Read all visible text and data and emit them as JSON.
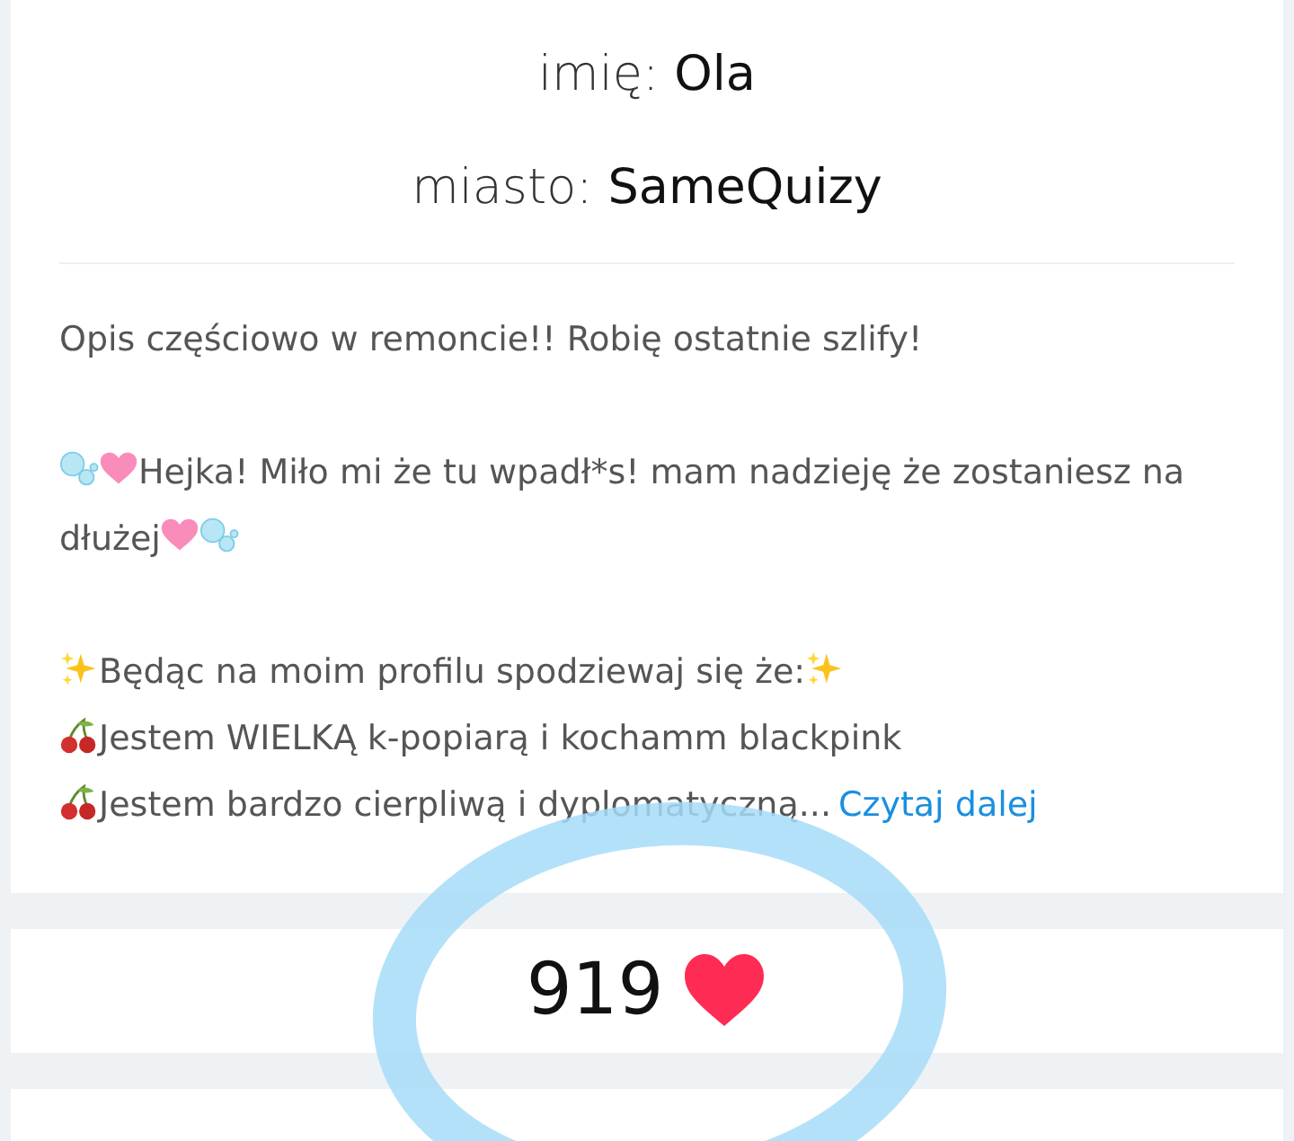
{
  "profile_fields": [
    {
      "label": "imię:",
      "value": "Ola"
    },
    {
      "label": "miasto:",
      "value": "SameQuizy"
    }
  ],
  "description": {
    "paragraphs": [
      [
        [
          {
            "kind": "text",
            "text": "Opis częściowo w remoncie!! Robię ostatnie szlify!"
          }
        ]
      ],
      [
        [
          {
            "kind": "bubbles"
          },
          {
            "kind": "heart"
          },
          {
            "kind": "text",
            "text": "Hejka! Miło mi że tu wpadł*s! mam nadzieję że zostaniesz na"
          }
        ],
        [
          {
            "kind": "text",
            "text": "dłużej"
          },
          {
            "kind": "heart"
          },
          {
            "kind": "bubbles"
          }
        ]
      ],
      [
        [
          {
            "kind": "sparkles"
          },
          {
            "kind": "text",
            "text": "Będąc na moim profilu spodziewaj się że:"
          },
          {
            "kind": "sparkles"
          }
        ],
        [
          {
            "kind": "cherries"
          },
          {
            "kind": "text",
            "text": "Jestem WIELKĄ k-popiarą i kochamm blackpink"
          }
        ],
        [
          {
            "kind": "cherries"
          },
          {
            "kind": "text",
            "text": "Jestem bardzo cierpliwą i dyplomatyczną..."
          },
          {
            "kind": "link",
            "text": "Czytaj dalej"
          }
        ]
      ]
    ]
  },
  "likes": {
    "count": "919"
  }
}
